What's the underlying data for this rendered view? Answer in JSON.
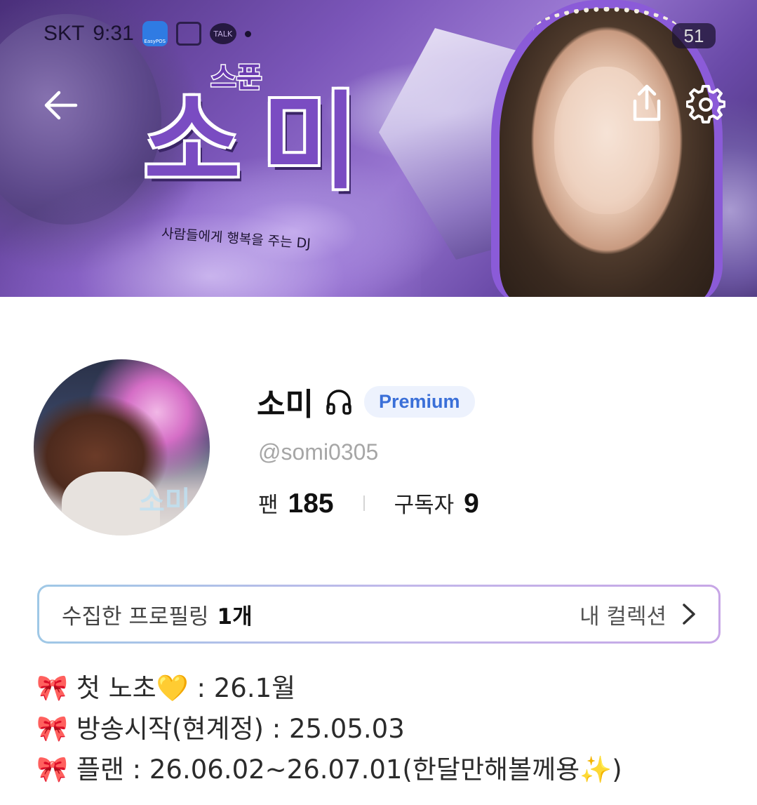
{
  "status_bar": {
    "carrier": "SKT",
    "time": "9:31",
    "app_badge_label": "EasyPOS",
    "talk_label": "TALK",
    "battery": "51"
  },
  "banner": {
    "sub_title": "스푼",
    "title": "소미",
    "tagline": "사람들에게 행복을 주는 DJ",
    "accent_color": "#8b5bd8"
  },
  "nav": {
    "back_icon": "arrow-left-icon",
    "share_icon": "share-icon",
    "settings_icon": "gear-icon"
  },
  "profile": {
    "name": "소미",
    "badge": "Premium",
    "handle": "@somi0305",
    "avatar_overlay_text": "소미",
    "stats": [
      {
        "label": "팬",
        "value": "185"
      },
      {
        "label": "구독자",
        "value": "9"
      }
    ]
  },
  "collection": {
    "label": "수집한 프로필링",
    "count": "1개",
    "link_label": "내 컬렉션"
  },
  "bio": [
    {
      "icon": "🎀",
      "text": "첫 노초💛 : 26.1월"
    },
    {
      "icon": "🎀",
      "text": "방송시작(현계정) : 25.05.03"
    },
    {
      "icon": "🎀",
      "text": "플랜 : 26.06.02~26.07.01(한달만해볼께용✨)"
    }
  ]
}
